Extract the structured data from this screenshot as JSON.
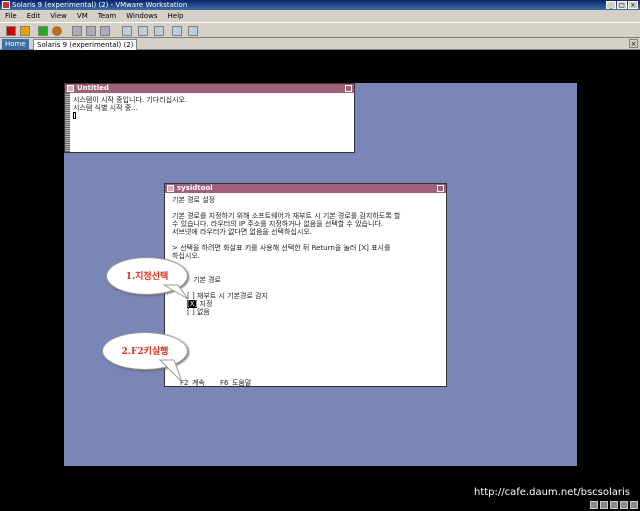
{
  "app": {
    "title": "Solaris 9 (experimental) (2) - VMware Workstation",
    "window_buttons": [
      "_",
      "□",
      "×"
    ]
  },
  "menu": [
    "File",
    "Edit",
    "View",
    "VM",
    "Team",
    "Windows",
    "Help"
  ],
  "toolbar_icons": [
    "stop-icon",
    "pause-icon",
    "play-icon",
    "reset-icon",
    "snapshot-icon",
    "revert-icon",
    "manage-snapshots-icon",
    "fullscreen-icon",
    "quick-switch-icon",
    "summary-icon",
    "console-icon"
  ],
  "tabs": [
    {
      "label": "Home"
    },
    {
      "label": "Solaris 9 (experimental) (2)"
    }
  ],
  "console": {
    "title": "Untitled",
    "lines": [
      "시스템이 시작 중입니다. 기다리십시오.",
      "시스템 식별 시작 중..."
    ]
  },
  "sysidtool": {
    "title": "sysidtool",
    "heading": "기본 경로 설정",
    "para1": [
      "기본 경로를 지정하기 위해 소프트웨어가 재부트 시 기본 경로를 감지하도록 할",
      "수 있습니다. 라우터의 IP 주소를 지정하거나 없음을 선택할 수 있습니다.",
      "서브넷에 라우터가 없다면 없음을 선택하십시오."
    ],
    "para2": [
      "> 선택을 하려면 화살표 키를 사용해 선택한 뒤 Return을 눌러 [X] 표시를",
      "하십시오."
    ],
    "section": "기본 경로",
    "options": [
      {
        "mark": "[ ]",
        "label": "재부트 시 기본경로 감지"
      },
      {
        "mark": "[X]",
        "label": "지정"
      },
      {
        "mark": "[ ]",
        "label": "없음"
      }
    ],
    "footer": [
      "F2_계속",
      "F6_도움말"
    ]
  },
  "callouts": [
    "1.지정선택",
    "2.F2키실행"
  ],
  "watermark": "http://cafe.daum.net/bscsolaris"
}
